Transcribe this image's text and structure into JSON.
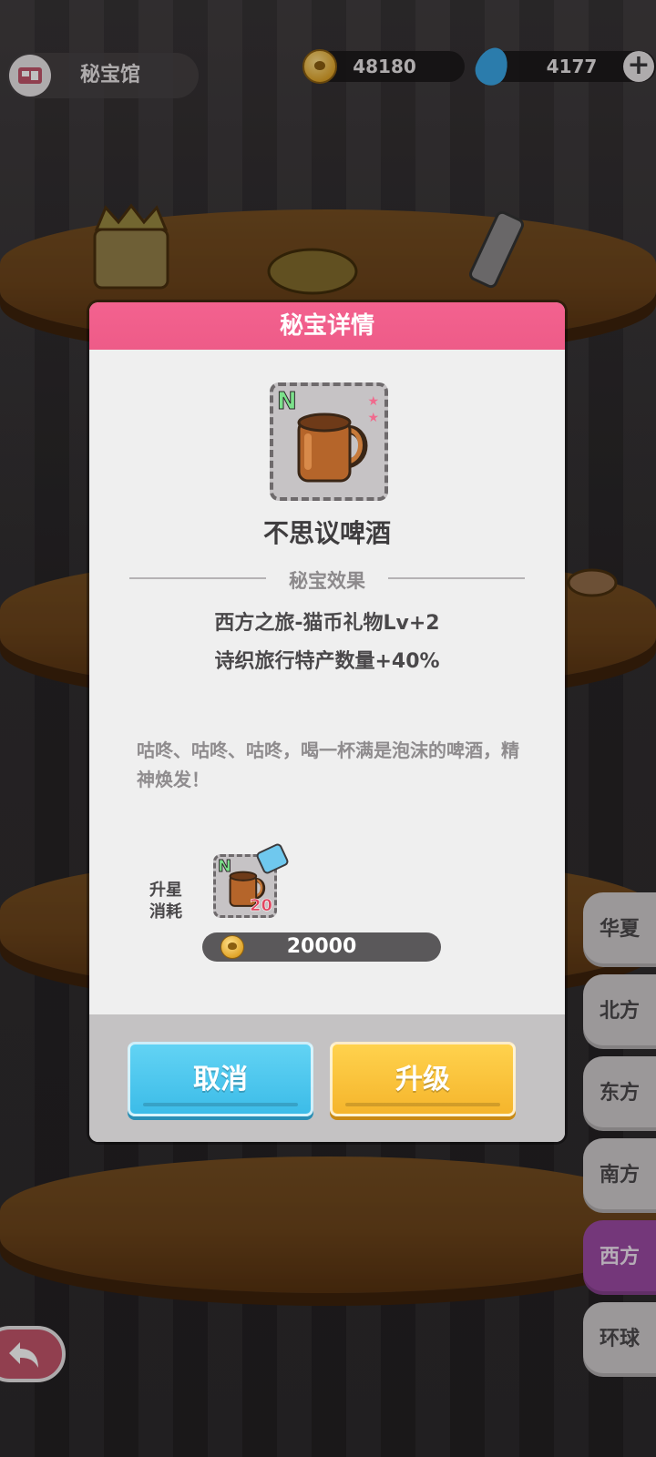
{
  "header": {
    "museum_title": "秘宝馆",
    "coins": "48180",
    "gems": "4177"
  },
  "dialog": {
    "title": "秘宝详情",
    "item": {
      "rarity": "N",
      "name": "不思议啤酒"
    },
    "effect_title": "秘宝效果",
    "effects": [
      "西方之旅-猫币礼物Lv+2",
      "诗织旅行特产数量+40%"
    ],
    "description": "咕咚、咕咚、咕咚，喝一杯满是泡沫的啤酒，精神焕发！",
    "cost": {
      "label": "升星\n消耗",
      "material_rarity": "N",
      "material_count": "20",
      "coin_cost": "20000"
    },
    "buttons": {
      "cancel": "取消",
      "upgrade": "升级"
    }
  },
  "side_tabs": [
    "华夏",
    "北方",
    "东方",
    "南方",
    "西方",
    "环球"
  ],
  "active_tab": "西方",
  "colors": {
    "header_pink": "#ee5b88",
    "cancel_blue": "#3cbce8",
    "upgrade_yellow": "#f5b52c",
    "active_tab_purple": "#9b4aa3"
  }
}
